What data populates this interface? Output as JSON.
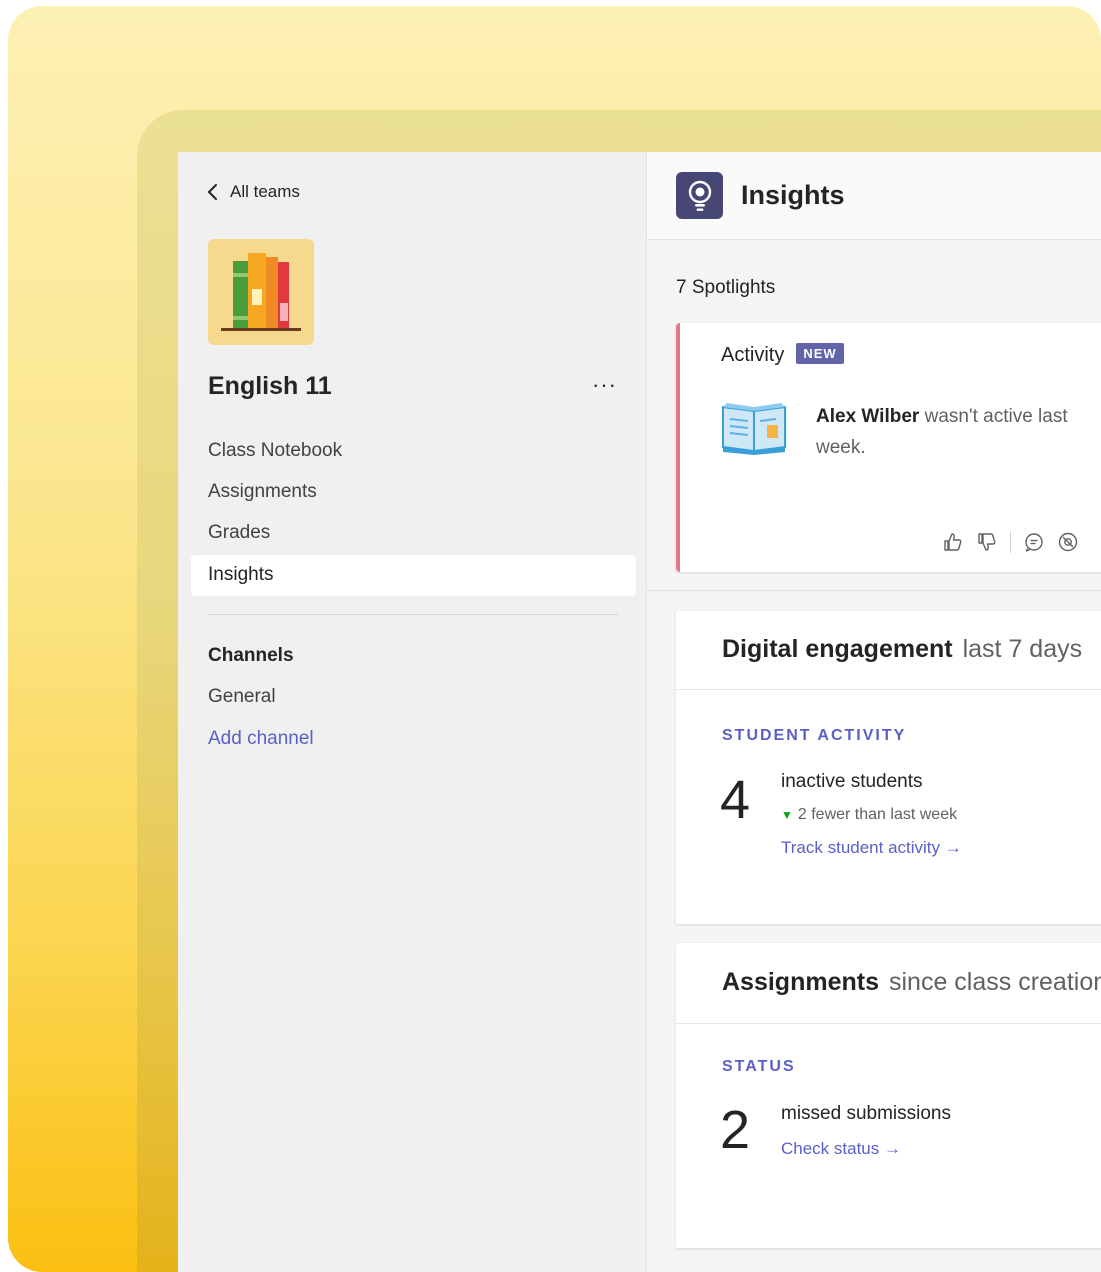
{
  "sidebar": {
    "back_label": "All teams",
    "team_name": "English 11",
    "more_label": "···",
    "nav": [
      "Class Notebook",
      "Assignments",
      "Grades",
      "Insights"
    ],
    "channels_heading": "Channels",
    "channels": [
      "General"
    ],
    "add_channel": "Add channel"
  },
  "header": {
    "title": "Insights"
  },
  "spotlights": {
    "count_label": "7 Spotlights",
    "card": {
      "heading": "Activity",
      "badge": "NEW",
      "name": "Alex Wilber",
      "message": " wasn't active last week."
    }
  },
  "engagement": {
    "title": "Digital engagement",
    "subtitle": "last 7 days",
    "eyebrow": "STUDENT ACTIVITY",
    "value": "4",
    "label": "inactive students",
    "trend": "2 fewer than last week",
    "link": "Track student activity →"
  },
  "assignments": {
    "title": "Assignments",
    "subtitle": "since class creation",
    "eyebrow": "STATUS",
    "value": "2",
    "label": "missed submissions",
    "link": "Check status →"
  },
  "colors": {
    "accent": "#5b5fc7",
    "badge": "#6264a7",
    "spotlight_border": "#e07b85",
    "trend_down": "#13a10e"
  },
  "icons": [
    "chevron-left-icon",
    "books-icon",
    "lightbulb-icon",
    "open-book-icon",
    "thumbs-up-icon",
    "thumbs-down-icon",
    "comment-icon",
    "dismiss-icon"
  ]
}
